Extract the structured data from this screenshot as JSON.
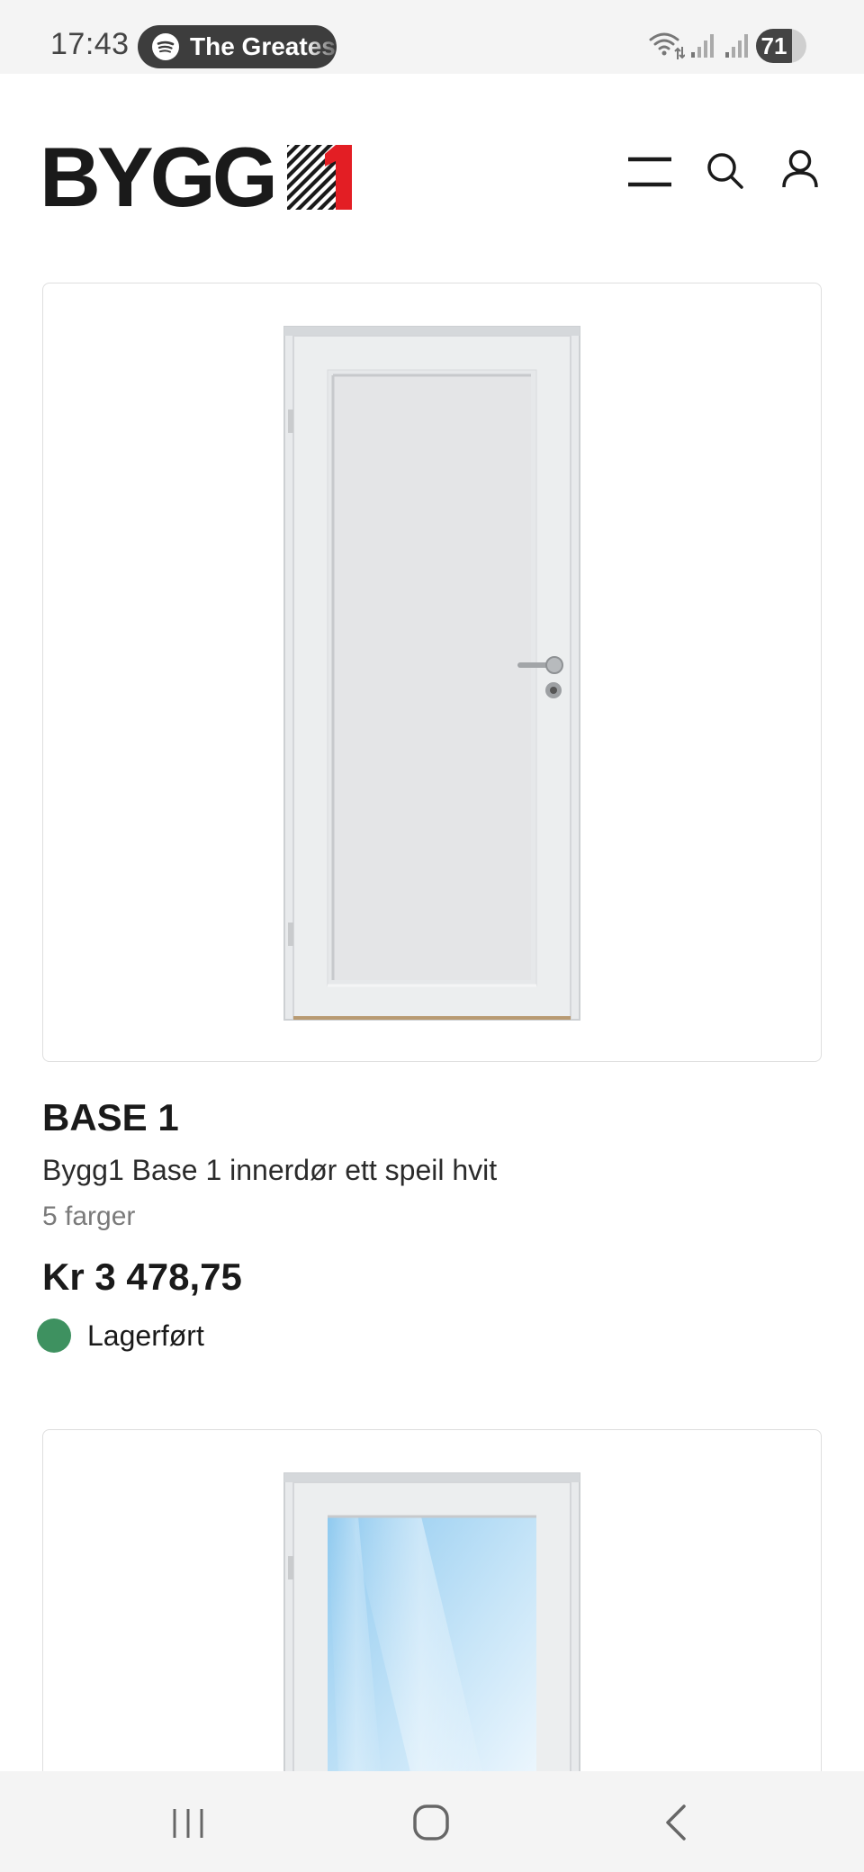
{
  "status_bar": {
    "time": "17:43",
    "media_title": "The Greatest",
    "battery": "71",
    "battery_level": 0.71
  },
  "header": {
    "logo_text": "BYGG",
    "logo_digit": "1",
    "icons": [
      "menu-icon",
      "search-icon",
      "user-icon"
    ]
  },
  "colors": {
    "brand_red": "#e31e24",
    "stock_green": "#3e9160",
    "text_dark": "#1a1a1a",
    "text_muted": "#7a7a7a"
  },
  "products": [
    {
      "name": "BASE 1",
      "description": "Bygg1 Base 1 innerdør ett speil hvit",
      "colors_label": "5 farger",
      "price": "Kr 3 478,75",
      "stock_status": "Lagerført",
      "image": "white-panel-door"
    },
    {
      "image": "white-glass-door"
    }
  ],
  "nav_bar": {
    "icons": [
      "recent-apps-icon",
      "home-icon",
      "back-icon"
    ]
  }
}
